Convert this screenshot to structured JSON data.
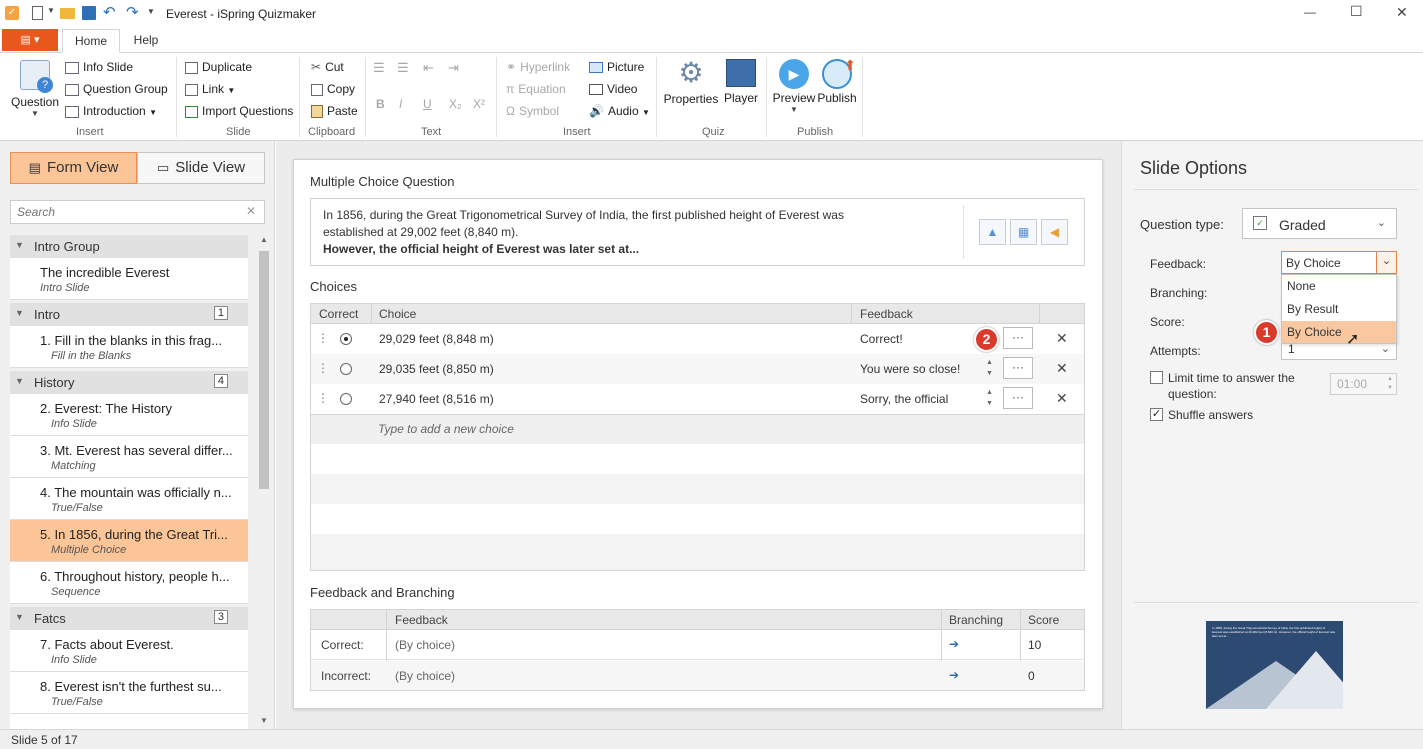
{
  "titlebar": {
    "title": "Everest - iSpring Quizmaker",
    "minimize": "—",
    "maximize": "☐",
    "close": "✕"
  },
  "tabs": {
    "home": "Home",
    "help": "Help"
  },
  "ribbon": {
    "question": "Question",
    "info_slide": "Info Slide",
    "question_group": "Question Group",
    "introduction": "Introduction",
    "duplicate": "Duplicate",
    "link": "Link",
    "import_questions": "Import Questions",
    "cut": "Cut",
    "copy": "Copy",
    "paste": "Paste",
    "hyperlink": "Hyperlink",
    "equation": "Equation",
    "symbol": "Symbol",
    "picture": "Picture",
    "video": "Video",
    "audio": "Audio",
    "properties": "Properties",
    "player": "Player",
    "preview": "Preview",
    "publish": "Publish",
    "groups": {
      "insert": "Insert",
      "slide": "Slide",
      "clipboard": "Clipboard",
      "text": "Text",
      "insert2": "Insert",
      "quiz": "Quiz",
      "publish": "Publish"
    },
    "fmt": {
      "b": "B",
      "i": "I",
      "u": "U",
      "sub": "X₂",
      "sup": "X²"
    }
  },
  "left": {
    "form_view": "Form View",
    "slide_view": "Slide View",
    "search_placeholder": "Search",
    "groups": [
      {
        "name": "Intro Group",
        "count": ""
      },
      {
        "name": "Intro",
        "count": "1"
      },
      {
        "name": "History",
        "count": "4"
      },
      {
        "name": "Fatcs",
        "count": "3"
      }
    ],
    "items": [
      {
        "title": "The incredible Everest",
        "sub": "Intro Slide"
      },
      {
        "title": "1.  Fill in the blanks in this frag...",
        "sub": "Fill in the Blanks"
      },
      {
        "title": "2.  Everest: The History",
        "sub": "Info Slide"
      },
      {
        "title": "3.  Mt. Everest has several differ...",
        "sub": "Matching"
      },
      {
        "title": "4.  The mountain was officially n...",
        "sub": "True/False"
      },
      {
        "title": "5.  In 1856, during the Great Tri...",
        "sub": "Multiple Choice"
      },
      {
        "title": "6.  Throughout history, people h...",
        "sub": "Sequence"
      },
      {
        "title": "7.  Facts about Everest.",
        "sub": "Info Slide"
      },
      {
        "title": "8.  Everest isn't the furthest su...",
        "sub": "True/False"
      }
    ]
  },
  "question": {
    "heading": "Multiple Choice Question",
    "text1": "In 1856, during the Great Trigonometrical Survey of India, the first published height of Everest was established at 29,002 feet (8,840 m).",
    "text2": "However, the official height of Everest was later set at..."
  },
  "choices": {
    "heading": "Choices",
    "col_correct": "Correct",
    "col_choice": "Choice",
    "col_feedback": "Feedback",
    "rows": [
      {
        "choice": "29,029 feet (8,848 m)",
        "feedback": "Correct!"
      },
      {
        "choice": "29,035 feet (8,850 m)",
        "feedback": "You were so close!"
      },
      {
        "choice": "27,940 feet (8,516 m)",
        "feedback": "Sorry, the official"
      }
    ],
    "new_placeholder": "Type to add a new choice",
    "more": "···",
    "remove": "✕"
  },
  "fb": {
    "heading": "Feedback and Branching",
    "col_feedback": "Feedback",
    "col_branching": "Branching",
    "col_score": "Score",
    "rows": [
      {
        "label": "Correct:",
        "feedback": "(By choice)",
        "score": "10"
      },
      {
        "label": "Incorrect:",
        "feedback": "(By choice)",
        "score": "0"
      }
    ],
    "arrow": "➔"
  },
  "options": {
    "title": "Slide Options",
    "question_type_label": "Question type:",
    "question_type_value": "Graded",
    "feedback_label": "Feedback:",
    "feedback_value": "By Choice",
    "branching_label": "Branching:",
    "score_label": "Score:",
    "attempts_label": "Attempts:",
    "attempts_value": "1",
    "limit_time": "Limit time to answer the question:",
    "time_value": "01:00",
    "shuffle": "Shuffle answers",
    "dropdown": [
      "None",
      "By Result",
      "By Choice"
    ]
  },
  "callouts": {
    "one": "1",
    "two": "2"
  },
  "thumb": {
    "text": "In 1856, during the Great Trigonometrical Survey of India, the first published height of Everest was established at 29,002 feet (8,840 m). However, the official height of Everest was later set at..."
  },
  "status": {
    "text": "Slide 5 of 17"
  },
  "colors": {
    "accent": "#e8581c",
    "selection": "#fbc597",
    "dropdown_sel": "#f9c8a0"
  }
}
